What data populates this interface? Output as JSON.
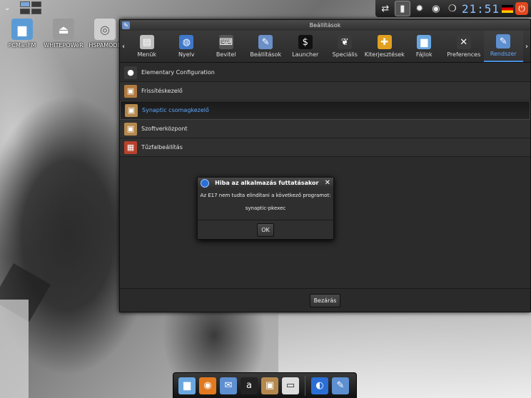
{
  "desktop": {
    "icons": [
      {
        "label": "PCManFM",
        "icon": "folder-icon",
        "color": "#5b9bd5"
      },
      {
        "label": "WHITEPOWeR",
        "icon": "eject-icon",
        "color": "#9a9a9a"
      },
      {
        "label": "HSPAMODE",
        "icon": "disc-icon",
        "color": "#cfcfcf"
      }
    ]
  },
  "top_shelf": {
    "menu_chevron": "⌄",
    "clock": "21:51",
    "icons": [
      "network-icon",
      "signal-icon",
      "gear-icon",
      "camera-icon",
      "bulb-icon",
      "flag-icon",
      "power-icon"
    ]
  },
  "window": {
    "title": "Beállítások",
    "toolbar": {
      "left_arrow": "‹",
      "right_arrow": "›",
      "items": [
        {
          "label": "Menük",
          "icon": "menu-icon",
          "color": "#bfbfbf",
          "glyph": "▤"
        },
        {
          "label": "Nyelv",
          "icon": "globe-icon",
          "color": "#3f78c9",
          "glyph": "◍"
        },
        {
          "label": "Bevitel",
          "icon": "keyboard-icon",
          "color": "#555555",
          "glyph": "⌨"
        },
        {
          "label": "Beállítások",
          "icon": "settings-icon",
          "color": "#6b8fc7",
          "glyph": "✎"
        },
        {
          "label": "Launcher",
          "icon": "terminal-icon",
          "color": "#111111",
          "glyph": "$"
        },
        {
          "label": "Speciális",
          "icon": "feather-icon",
          "color": "#3a3a3a",
          "glyph": "❦"
        },
        {
          "label": "Kiterjesztések",
          "icon": "puzzle-icon",
          "color": "#e0a020",
          "glyph": "✚"
        },
        {
          "label": "Fájlok",
          "icon": "folder-icon",
          "color": "#6aa7e0",
          "glyph": "▆"
        },
        {
          "label": "Preferences",
          "icon": "tools-icon",
          "color": "#3a3a3a",
          "glyph": "✕"
        },
        {
          "label": "Rendszer",
          "icon": "system-icon",
          "color": "#5d8fd1",
          "glyph": "✎"
        }
      ],
      "active_index": 9
    },
    "rows": [
      {
        "label": "Elementary Configuration",
        "icon": "elementary-icon",
        "color": "#3a3a3a",
        "glyph": "●"
      },
      {
        "label": "Frissítéskezelő",
        "icon": "update-icon",
        "color": "#b07a3f",
        "glyph": "▣"
      },
      {
        "label": "Synaptic csomagkezelő",
        "icon": "package-icon",
        "color": "#b5894e",
        "glyph": "▣"
      },
      {
        "label": "Szoftverközpont",
        "icon": "software-center-icon",
        "color": "#b5894e",
        "glyph": "▣"
      },
      {
        "label": "Tűzfalbeállítás",
        "icon": "firewall-icon",
        "color": "#b8412c",
        "glyph": "▦"
      }
    ],
    "selected_row": 2,
    "close_button": "Bezárás"
  },
  "dialog": {
    "title": "Hiba az alkalmazás futtatásakor",
    "close_glyph": "✕",
    "message": "Az E17 nem tudta elindítani a következő programot:",
    "program": "synaptic-pkexec",
    "ok_button": "OK"
  },
  "dock": {
    "items": [
      {
        "icon": "folder-icon",
        "color": "#6aa7e0",
        "glyph": "▆"
      },
      {
        "icon": "eye-icon",
        "color": "#e07a20",
        "glyph": "◉"
      },
      {
        "icon": "stamp-icon",
        "color": "#5d8fd1",
        "glyph": "✉"
      },
      {
        "icon": "font-icon",
        "color": "#222222",
        "glyph": "a"
      },
      {
        "icon": "package-icon",
        "color": "#b5894e",
        "glyph": "▣"
      },
      {
        "icon": "drive-icon",
        "color": "#dddddd",
        "glyph": "▭"
      },
      {
        "icon": "e17-icon",
        "color": "#2b6fd6",
        "glyph": "◐"
      },
      {
        "icon": "settings-icon",
        "color": "#5d8fd1",
        "glyph": "✎"
      }
    ]
  }
}
